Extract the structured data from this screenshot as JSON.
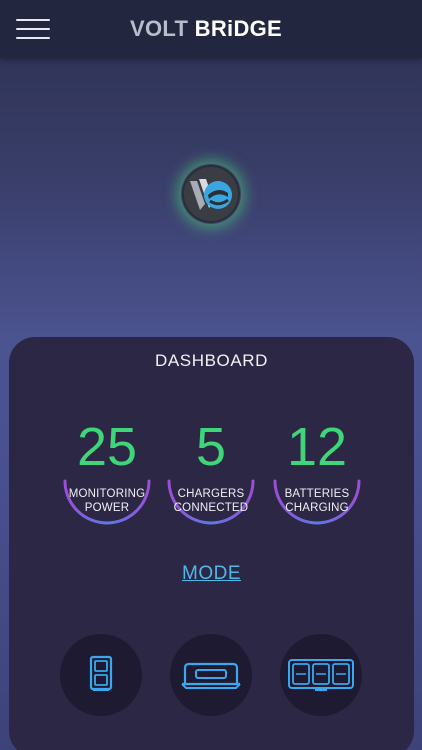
{
  "header": {
    "menu_icon": "hamburger-menu-icon",
    "brand_part1": "VOLT",
    "brand_part2": "BRiDGE"
  },
  "logo": {
    "icon": "voltbridge-logo-icon"
  },
  "dashboard": {
    "title": "DASHBOARD",
    "stats": [
      {
        "value": "25",
        "label_line1": "MONITORING",
        "label_line2": "POWER"
      },
      {
        "value": "5",
        "label_line1": "CHARGERS",
        "label_line2": "CONNECTED"
      },
      {
        "value": "12",
        "label_line1": "BATTERIES",
        "label_line2": "CHARGING"
      }
    ],
    "mode_label": "MODE",
    "mode_buttons": [
      {
        "icon": "single-battery-icon"
      },
      {
        "icon": "charger-dock-icon"
      },
      {
        "icon": "battery-bank-icon"
      }
    ]
  },
  "colors": {
    "accent_green": "#3fd67a",
    "link_blue": "#4fb8e8",
    "icon_blue": "#39a8ee",
    "card_bg": "#2b2744"
  }
}
